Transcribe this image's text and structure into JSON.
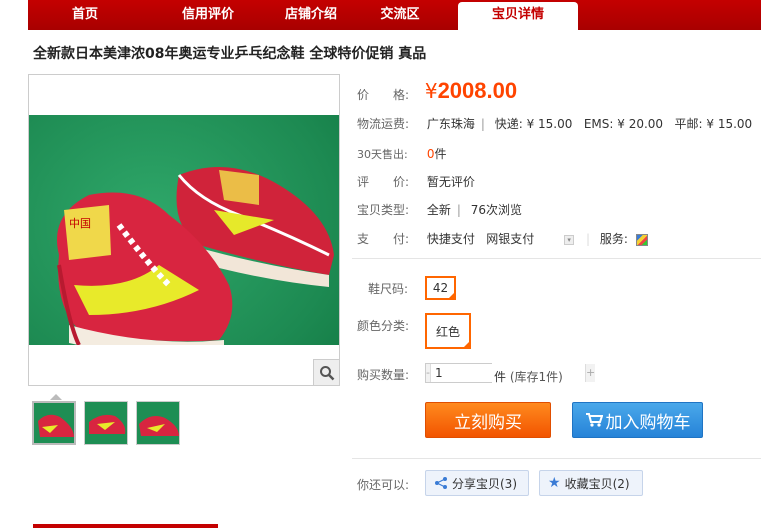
{
  "nav": {
    "items": [
      {
        "label": "首页"
      },
      {
        "label": "信用评价"
      },
      {
        "label": "店铺介绍"
      },
      {
        "label": "交流区"
      },
      {
        "label": "宝贝详情"
      }
    ],
    "active": "宝贝详情"
  },
  "product": {
    "title": "全新款日本美津浓08年奥运专业乒乓纪念鞋 全球特价促销 真品",
    "image_text": "中国"
  },
  "details": {
    "price_label": "价　　格:",
    "price_currency": "¥",
    "price": "2008.00",
    "logistics_label": "物流运费:",
    "logistics_location": "广东珠海",
    "logistics_express": "快递: ¥ 15.00",
    "logistics_ems": "EMS: ¥ 20.00",
    "logistics_post": "平邮: ¥ 15.00",
    "sold_label": "30天售出:",
    "sold_value": "0",
    "sold_unit": "件",
    "rating_label": "评　　价:",
    "rating_value": "暂无评价",
    "type_label": "宝贝类型:",
    "type_value": "全新",
    "views": "76次浏览",
    "pay_label": "支　　付:",
    "pay_fast": "快捷支付",
    "pay_bank": "网银支付",
    "service_label": "服务:"
  },
  "options": {
    "size_label": "鞋尺码:",
    "size_value": "42",
    "color_label": "颜色分类:",
    "color_value": "红色"
  },
  "quantity": {
    "label": "购买数量:",
    "value": "1",
    "minus": "-",
    "plus": "+",
    "unit": "件",
    "stock": "(库存1件)"
  },
  "actions": {
    "buy_now": "立刻购买",
    "add_cart": "加入购物车"
  },
  "share": {
    "label": "你还可以:",
    "share_btn": "分享宝贝(3)",
    "fav_btn": "收藏宝贝(2)"
  },
  "colors": {
    "brand_red": "#c40000",
    "price_orange": "#ff4400",
    "buy_orange": "#f25400",
    "cart_blue": "#2683d8"
  }
}
